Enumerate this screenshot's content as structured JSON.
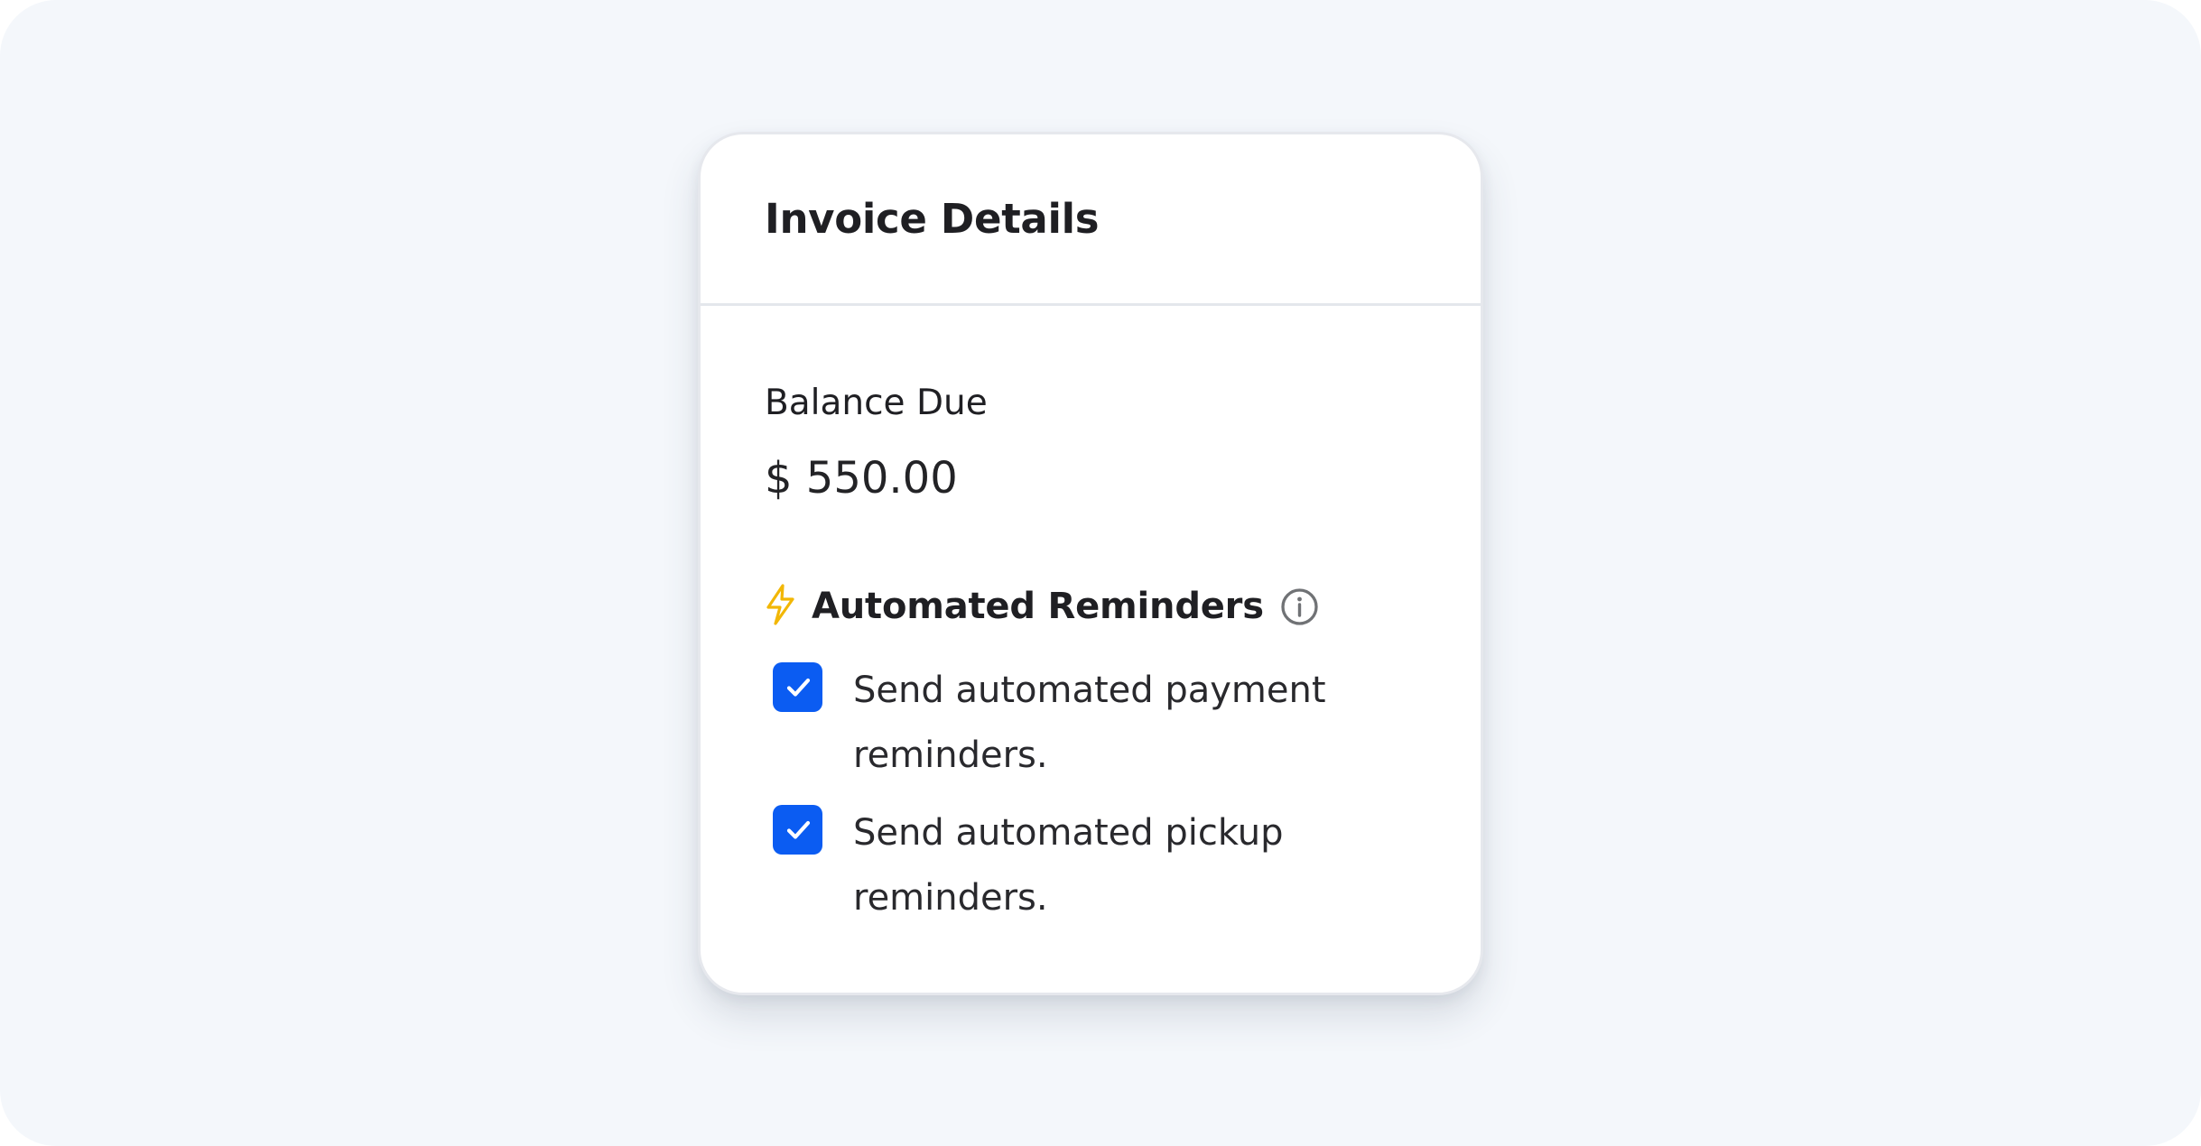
{
  "card": {
    "title": "Invoice Details"
  },
  "balance": {
    "label": "Balance Due",
    "value": "$ 550.00"
  },
  "reminders": {
    "heading": "Automated Reminders",
    "items": [
      {
        "label": "Send automated payment reminders.",
        "checked": true
      },
      {
        "label": "Send automated pickup reminders.",
        "checked": true
      }
    ]
  },
  "icons": {
    "heading_icon": "lightning-bolt-icon",
    "info_icon": "info-icon",
    "check_icon": "check-icon"
  },
  "colors": {
    "background": "#f4f7fb",
    "card": "#ffffff",
    "checkbox": "#0b5cf2",
    "bolt": "#f2b705",
    "text": "#1f1f23"
  }
}
